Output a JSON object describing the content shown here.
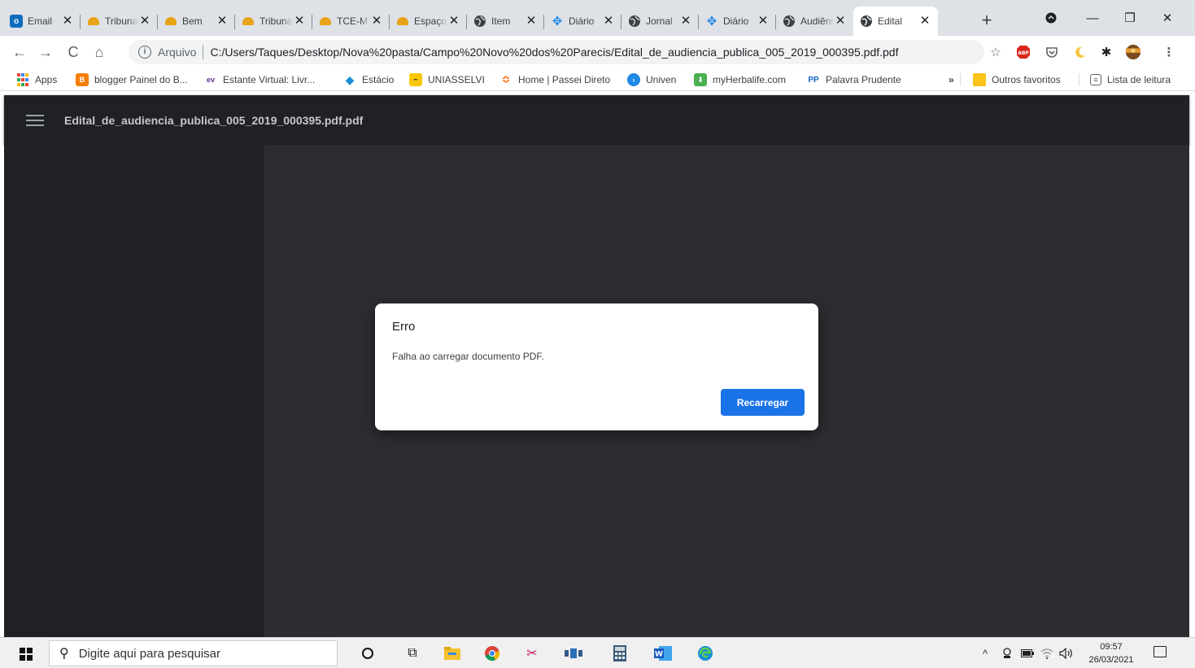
{
  "browser": {
    "tabs": [
      {
        "title": "Email",
        "favicon": "outlook-icon"
      },
      {
        "title": "Tribunal",
        "favicon": "tribunal-icon"
      },
      {
        "title": "Bem",
        "favicon": "tribunal-icon"
      },
      {
        "title": "Tribunal",
        "favicon": "tribunal-icon"
      },
      {
        "title": "TCE-MT",
        "favicon": "tribunal-icon"
      },
      {
        "title": "Espaço",
        "favicon": "tribunal-icon"
      },
      {
        "title": "Item",
        "favicon": "globe-icon"
      },
      {
        "title": "Diário",
        "favicon": "diamond-icon"
      },
      {
        "title": "Jornal",
        "favicon": "globe-icon"
      },
      {
        "title": "Diário",
        "favicon": "diamond-icon"
      },
      {
        "title": "Audiência",
        "favicon": "globe-icon"
      },
      {
        "title": "Edital",
        "favicon": "globe-icon",
        "active": true
      }
    ],
    "address": {
      "scheme_label": "Arquivo",
      "url": "C:/Users/Taques/Desktop/Nova%20pasta/Campo%20Novo%20dos%20Parecis/Edital_de_audiencia_publica_005_2019_000395.pdf.pdf"
    },
    "bookmarks": [
      {
        "label": "Apps",
        "icon": "apps-grid-icon"
      },
      {
        "label": "blogger Painel do B...",
        "icon": "blogger-icon"
      },
      {
        "label": "Estante Virtual: Livr...",
        "icon": "estante-icon"
      },
      {
        "label": "Estácio",
        "icon": "estacio-icon"
      },
      {
        "label": "UNIASSELVI",
        "icon": "uniasselvi-icon"
      },
      {
        "label": "Home | Passei Direto",
        "icon": "passei-icon"
      },
      {
        "label": "Univen",
        "icon": "univen-icon"
      },
      {
        "label": "myHerbalife.com",
        "icon": "herbalife-icon"
      },
      {
        "label": "Palavra Prudente",
        "icon": "pp-icon"
      }
    ],
    "bookmarks_overflow": "»",
    "other_bookmarks": "Outros favoritos",
    "reading_list": "Lista de leitura"
  },
  "pdf_viewer": {
    "filename": "Edital_de_audiencia_publica_005_2019_000395.pdf.pdf",
    "dialog": {
      "title": "Erro",
      "message": "Falha ao carregar documento PDF.",
      "button": "Recarregar"
    }
  },
  "taskbar": {
    "search_placeholder": "Digite aqui para pesquisar",
    "time": "09:57",
    "date": "26/03/2021"
  },
  "colors": {
    "accent": "#1a73e8",
    "viewer_bg": "#2c2d30",
    "toolbar_bg": "#202124",
    "tabstrip_bg": "#dee1e6"
  }
}
